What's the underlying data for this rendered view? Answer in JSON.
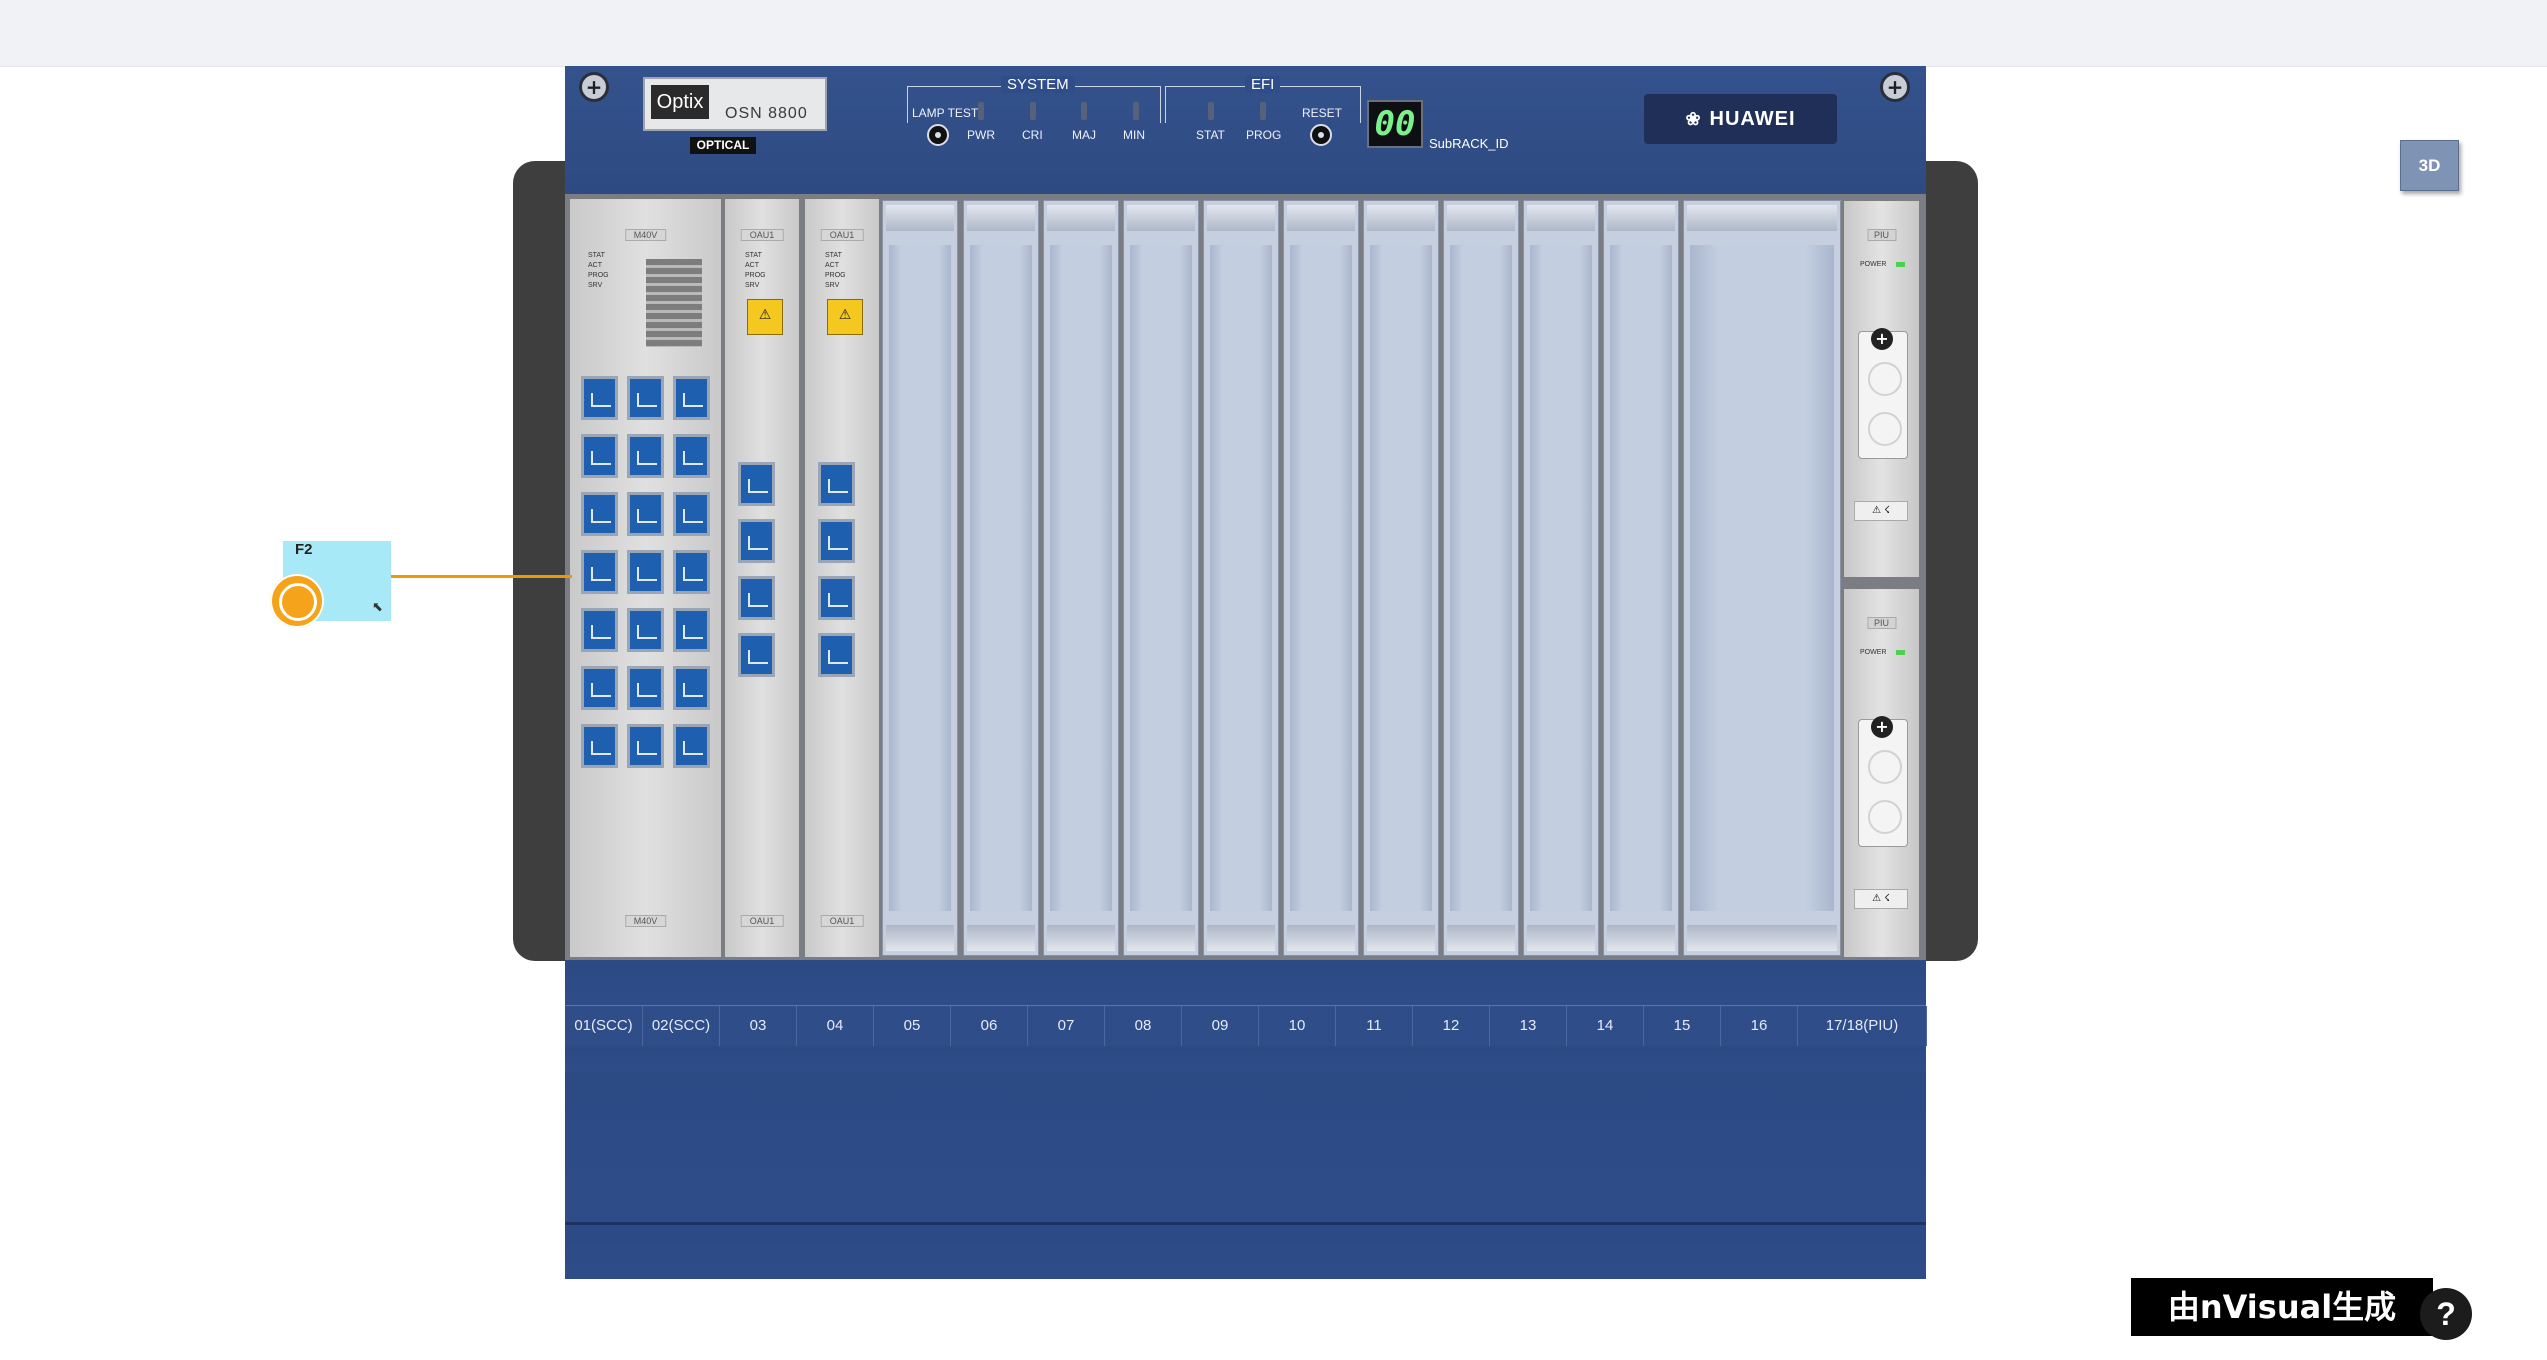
{
  "device": {
    "brand_logo": "Optix",
    "model": "OSN 8800",
    "series_tag": "OPTICAL",
    "vendor": "HUAWEI",
    "subrack_id": "00",
    "subrack_label": "SubRACK_ID"
  },
  "panel": {
    "system_title": "SYSTEM",
    "efi_title": "EFI",
    "lamp_test": "LAMP TEST",
    "reset": "RESET",
    "indicators": [
      "PWR",
      "CRI",
      "MAJ",
      "MIN",
      "STAT",
      "PROG"
    ]
  },
  "boards": {
    "scc": {
      "label": "M40V",
      "leds": [
        "STAT",
        "ACT",
        "PROG",
        "SRV"
      ]
    },
    "oau_a": {
      "label": "OAU1",
      "leds": [
        "STAT",
        "ACT",
        "PROG",
        "SRV"
      ]
    },
    "oau_b": {
      "label": "OAU1",
      "leds": [
        "STAT",
        "ACT",
        "PROG",
        "SRV"
      ]
    },
    "piu_top": {
      "label": "PIU",
      "power": "POWER"
    },
    "piu_bottom": {
      "label": "PIU",
      "power": "POWER"
    }
  },
  "slot_labels": [
    "01(SCC)",
    "02(SCC)",
    "03",
    "04",
    "05",
    "06",
    "07",
    "08",
    "09",
    "10",
    "11",
    "12",
    "13",
    "14",
    "15",
    "16",
    "17/18(PIU)"
  ],
  "port_tag": {
    "label": "F2"
  },
  "controls": {
    "view_3d": "3D",
    "help": "?"
  },
  "footer": {
    "brand": "由nVisual生成"
  },
  "colors": {
    "chassis": "#2e4c85",
    "accent": "#f5a31a",
    "tag_bg": "#a8e9f7"
  }
}
